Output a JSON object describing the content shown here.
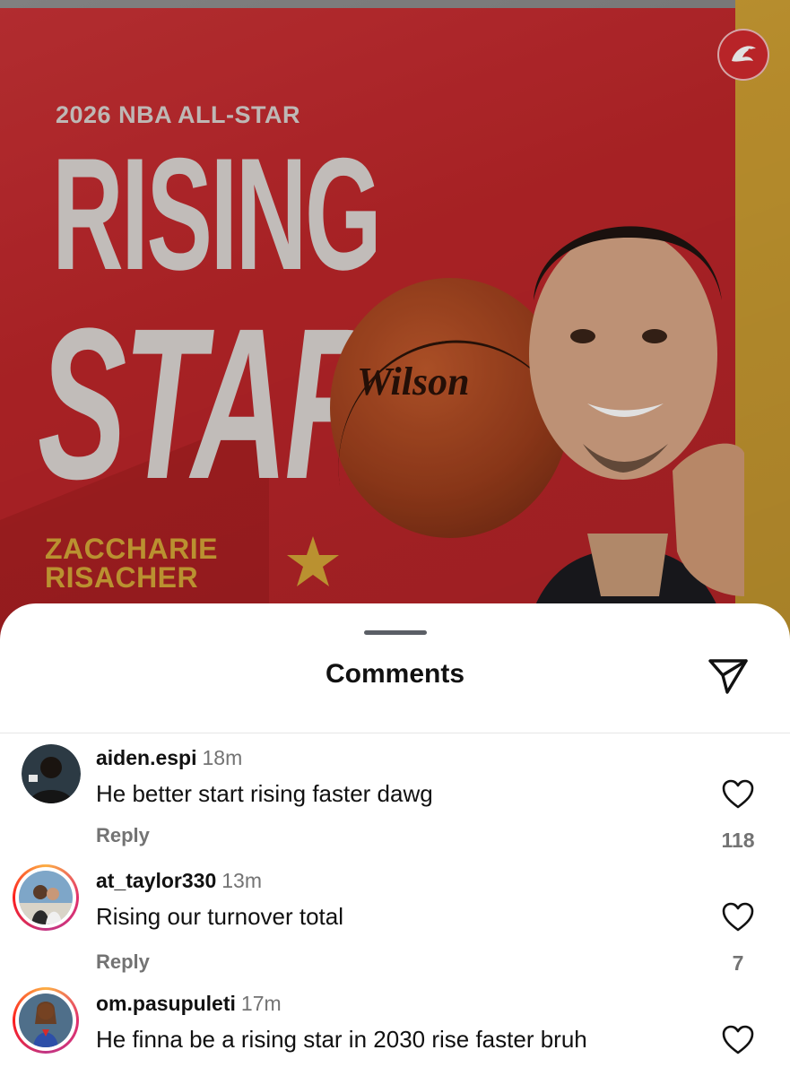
{
  "post": {
    "subtitle": "2026 NBA ALL-STAR",
    "headline_line1": "RISING",
    "headline_line2": "STAR",
    "player_first": "ZACCHARIE",
    "player_last": "RISACHER",
    "ball_brand": "Wilson",
    "colors": {
      "primary_red": "#c8282c",
      "gold": "#d4a637"
    }
  },
  "sheet": {
    "title": "Comments",
    "share_icon": "paper-plane-icon"
  },
  "comments": [
    {
      "username": "aiden.espi",
      "time": "18m",
      "text": "He better start rising faster dawg",
      "reply_label": "Reply",
      "likes": "118"
    },
    {
      "username": "at_taylor330",
      "time": "13m",
      "text": "Rising our turnover total",
      "reply_label": "Reply",
      "likes": "7"
    },
    {
      "username": "om.pasupuleti",
      "time": "17m",
      "text": "He finna be a rising star in 2030 rise faster bruh"
    }
  ]
}
